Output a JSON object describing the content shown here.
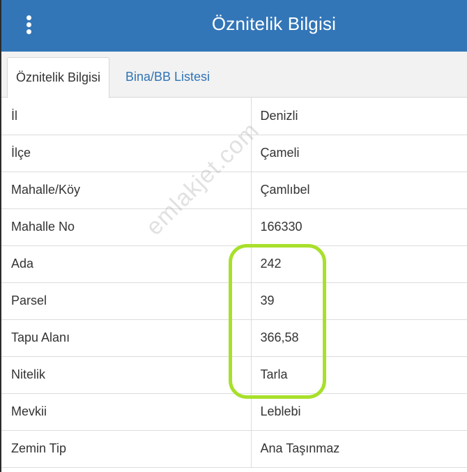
{
  "header": {
    "title": "Öznitelik Bilgisi",
    "menu_icon": "more-vertical-icon"
  },
  "tabs": [
    {
      "label": "Öznitelik Bilgisi",
      "active": true
    },
    {
      "label": "Bina/BB Listesi",
      "active": false
    }
  ],
  "rows": [
    {
      "key": "İl",
      "value": "Denizli"
    },
    {
      "key": "İlçe",
      "value": "Çameli"
    },
    {
      "key": "Mahalle/Köy",
      "value": "Çamlıbel"
    },
    {
      "key": "Mahalle No",
      "value": "166330"
    },
    {
      "key": "Ada",
      "value": "242"
    },
    {
      "key": "Parsel",
      "value": "39"
    },
    {
      "key": "Tapu Alanı",
      "value": "366,58"
    },
    {
      "key": "Nitelik",
      "value": "Tarla"
    },
    {
      "key": "Mevkii",
      "value": "Leblebi"
    },
    {
      "key": "Zemin Tip",
      "value": "Ana Taşınmaz"
    }
  ],
  "watermark": "emlakjet.com",
  "colors": {
    "header_bg": "#3276b8",
    "tab_link": "#2f73b5",
    "highlight": "#a8e02a"
  }
}
